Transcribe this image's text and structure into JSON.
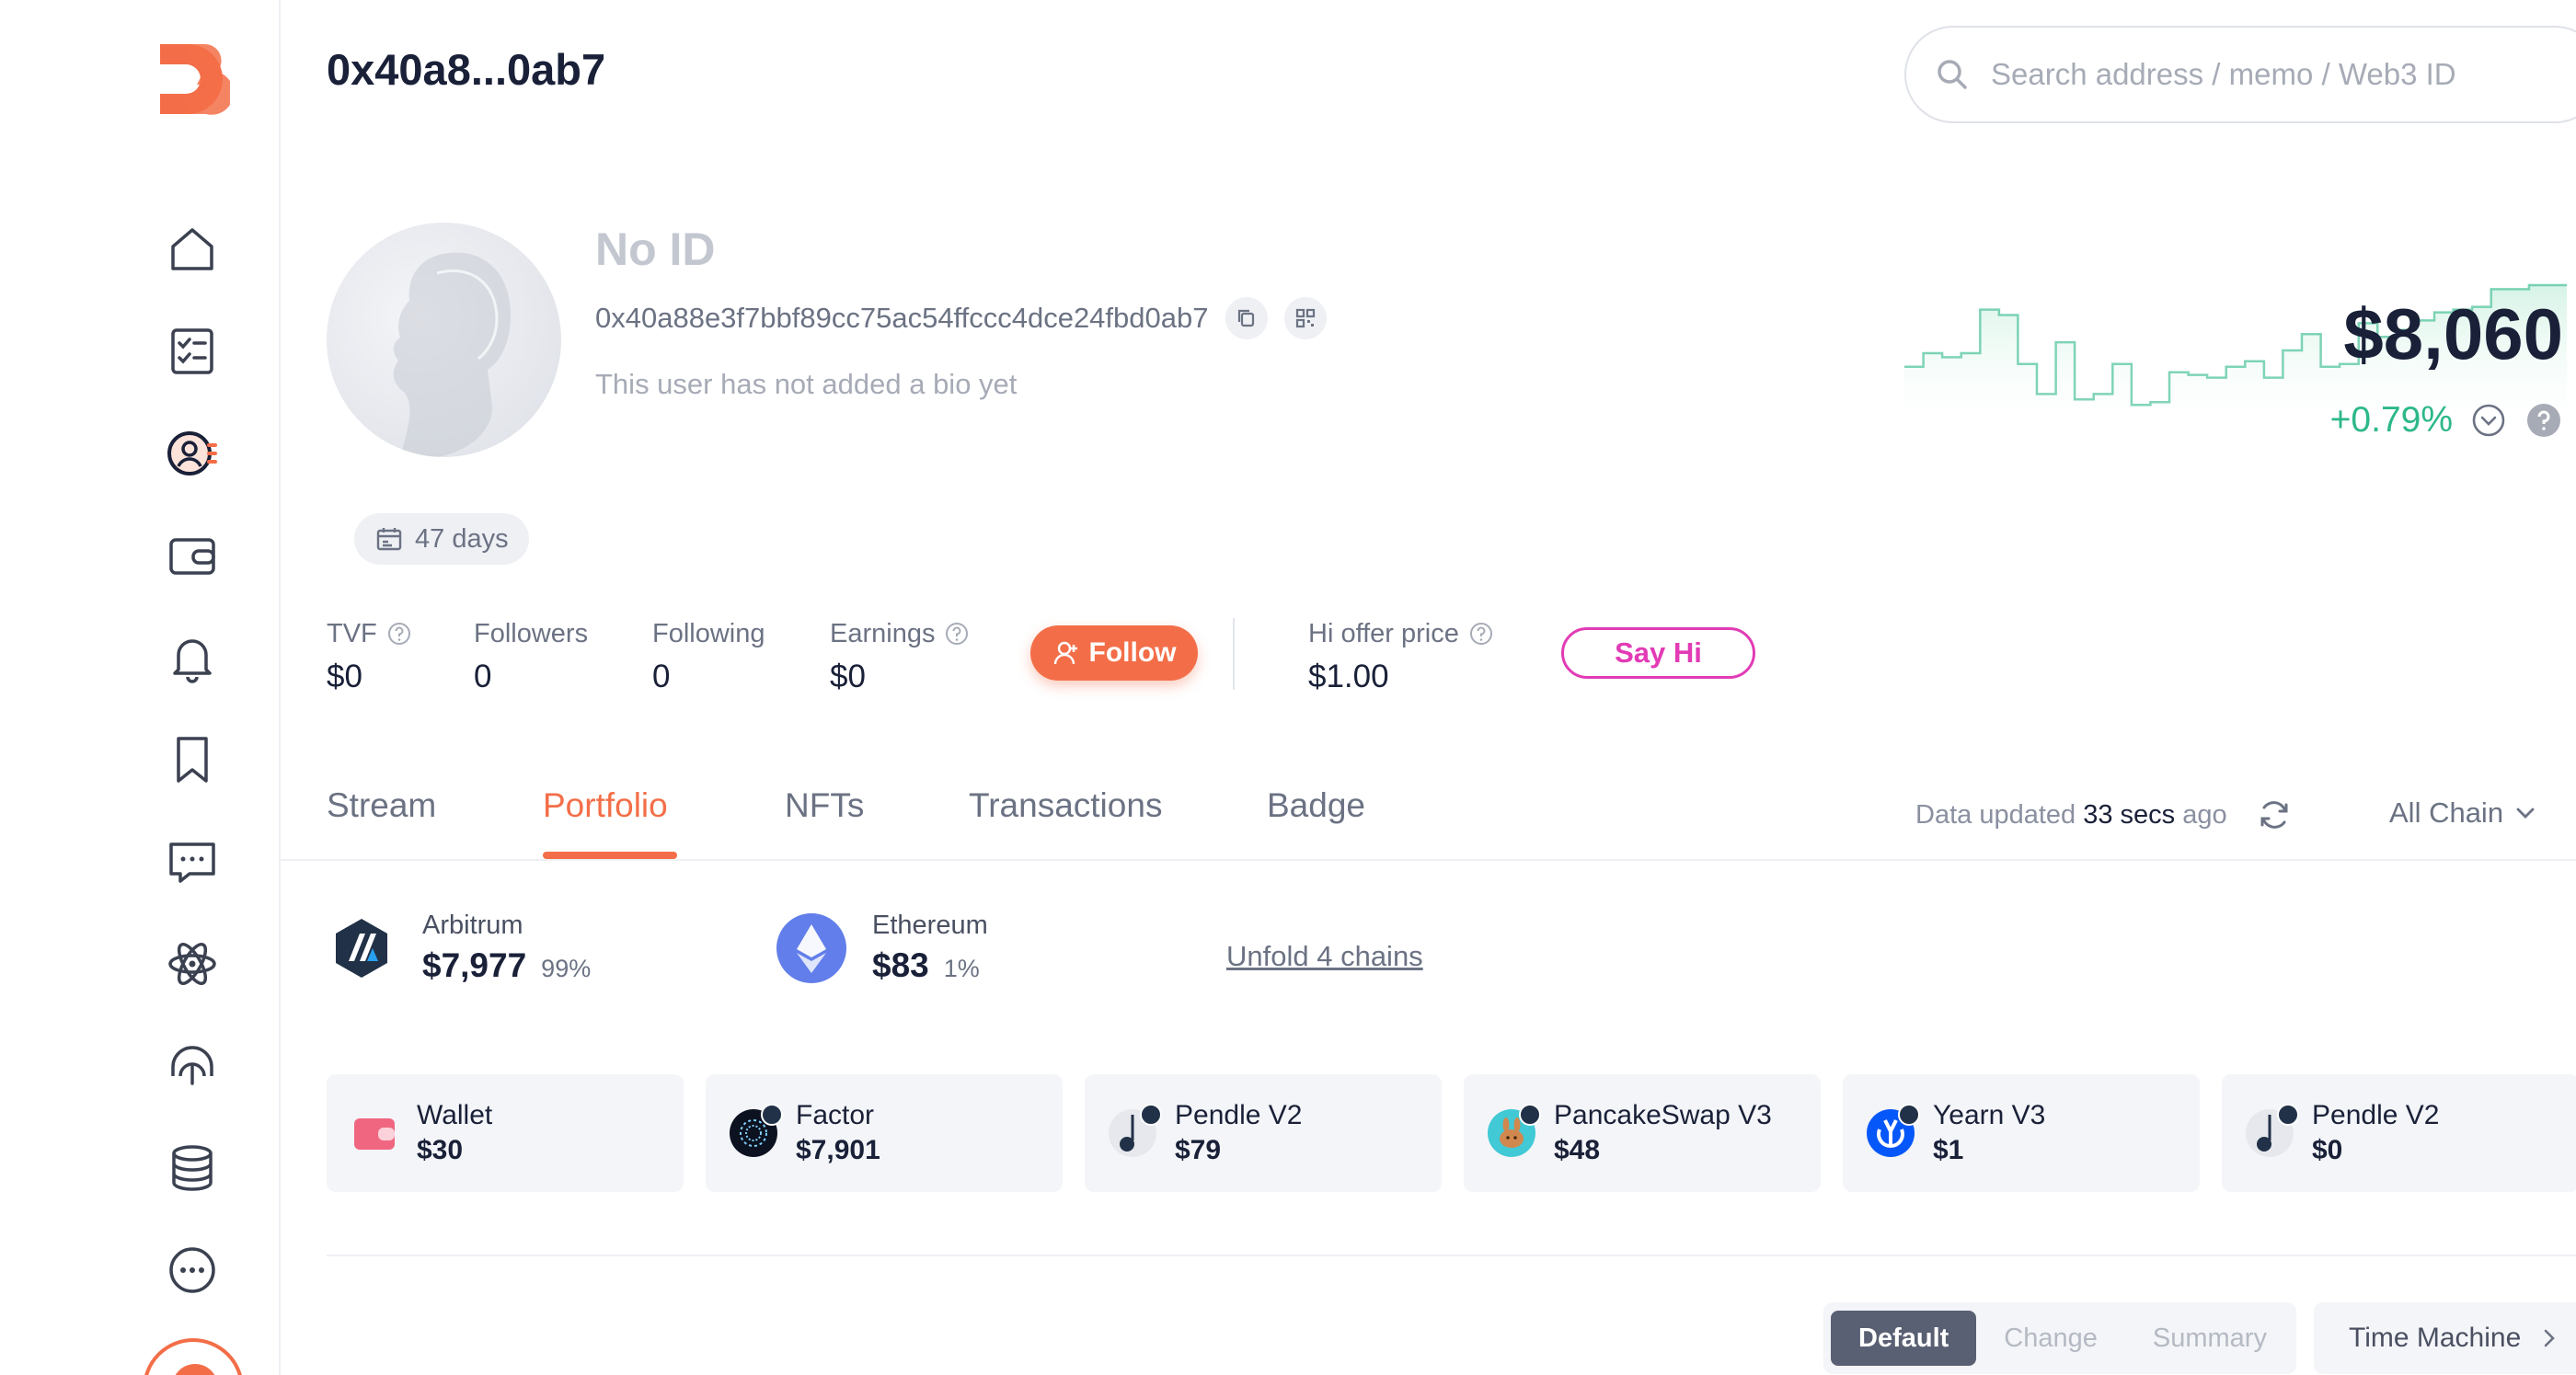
{
  "header": {
    "address_title": "0x40a8...0ab7",
    "search_placeholder": "Search address / memo / Web3 ID"
  },
  "sidebar": {
    "items": [
      {
        "icon": "home-icon"
      },
      {
        "icon": "checklist-icon"
      },
      {
        "icon": "profile-icon",
        "active": true
      },
      {
        "icon": "wallet-icon"
      },
      {
        "icon": "bell-icon"
      },
      {
        "icon": "bookmark-icon"
      },
      {
        "icon": "message-icon"
      },
      {
        "icon": "atom-icon"
      },
      {
        "icon": "headset-icon"
      },
      {
        "icon": "database-icon"
      },
      {
        "icon": "more-icon"
      }
    ]
  },
  "profile": {
    "name": "No ID",
    "full_address": "0x40a88e3f7bbf89cc75ac54ffccc4dce24fbd0ab7",
    "bio": "This user has not added a bio yet",
    "days": "47 days"
  },
  "stats": {
    "tvf_label": "TVF",
    "tvf_value": "$0",
    "followers_label": "Followers",
    "followers_value": "0",
    "following_label": "Following",
    "following_value": "0",
    "earnings_label": "Earnings",
    "earnings_value": "$0",
    "follow_label": "Follow",
    "hi_offer_label": "Hi offer price",
    "hi_offer_value": "$1.00",
    "say_hi_label": "Say Hi"
  },
  "value": {
    "amount": "$8,060",
    "change": "+0.79%",
    "trend": [
      0.62,
      0.52,
      0.55,
      0.52,
      0.2,
      0.24,
      0.6,
      0.82,
      0.44,
      0.86,
      0.82,
      0.6,
      0.9,
      0.88,
      0.66,
      0.68,
      0.7,
      0.62,
      0.58,
      0.7,
      0.5,
      0.38,
      0.62,
      0.6,
      0.3,
      0.4,
      0.35,
      0.28,
      0.22,
      0.2,
      0.18,
      0.05,
      0.05,
      0.02,
      0.02
    ],
    "colors": {
      "up": "#2cb888",
      "fill": "#d6f3e6"
    }
  },
  "tabs": [
    {
      "label": "Stream"
    },
    {
      "label": "Portfolio",
      "active": true
    },
    {
      "label": "NFTs"
    },
    {
      "label": "Transactions"
    },
    {
      "label": "Badge"
    }
  ],
  "data_updated": {
    "prefix": "Data updated",
    "time": "33 secs",
    "suffix": "ago"
  },
  "chain_filter": "All Chain",
  "chains": [
    {
      "name": "Arbitrum",
      "amount": "$7,977",
      "pct": "99%"
    },
    {
      "name": "Ethereum",
      "amount": "$83",
      "pct": "1%"
    }
  ],
  "unfold_label": "Unfold 4 chains",
  "protocols": [
    {
      "name": "Wallet",
      "value": "$30"
    },
    {
      "name": "Factor",
      "value": "$7,901"
    },
    {
      "name": "Pendle V2",
      "value": "$79"
    },
    {
      "name": "PancakeSwap V3",
      "value": "$48"
    },
    {
      "name": "Yearn V3",
      "value": "$1"
    },
    {
      "name": "Pendle V2",
      "value": "$0"
    }
  ],
  "view_modes": [
    {
      "label": "Default",
      "active": true
    },
    {
      "label": "Change"
    },
    {
      "label": "Summary"
    }
  ],
  "time_machine_label": "Time Machine",
  "colors": {
    "accent": "#f36e48",
    "say_hi": "#e23bb5",
    "positive": "#2cb888"
  }
}
